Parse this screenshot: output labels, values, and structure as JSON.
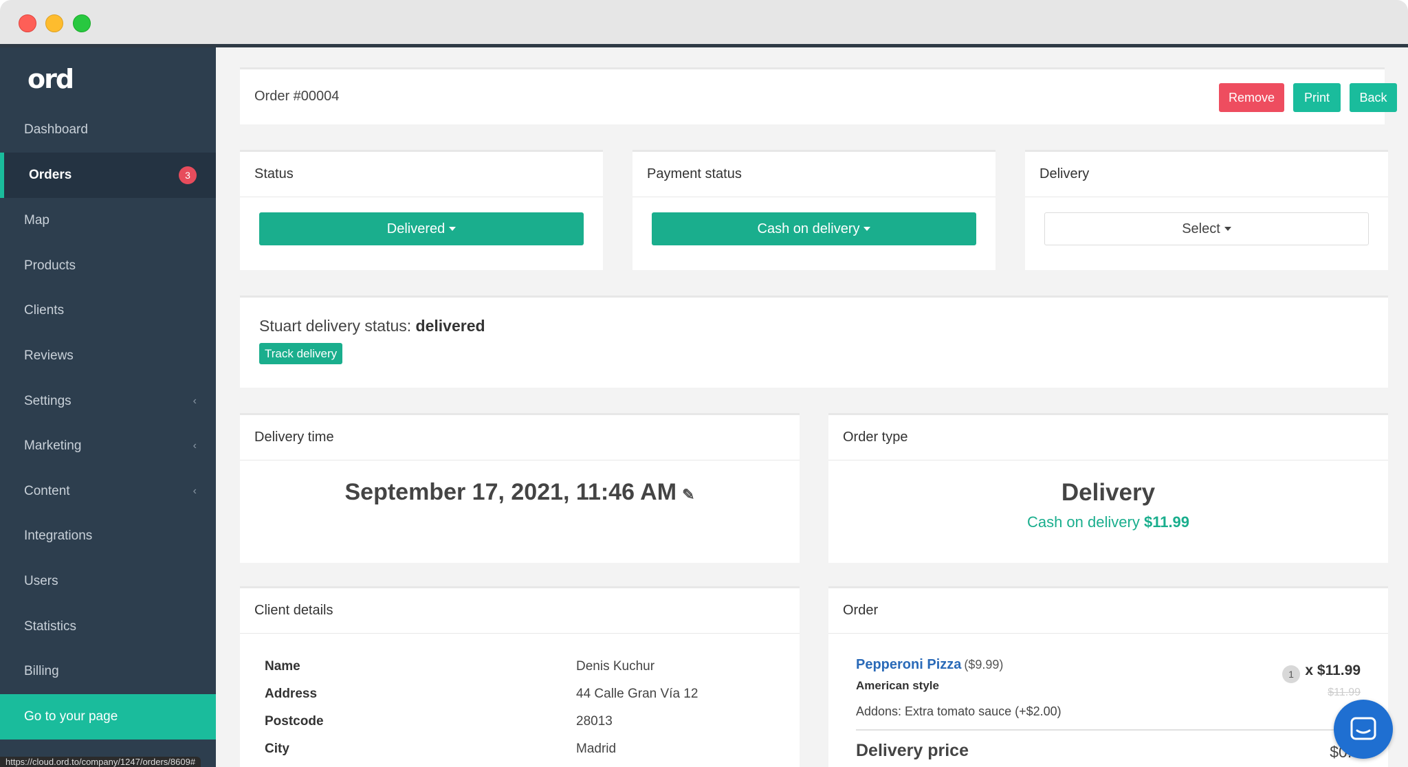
{
  "app": {
    "logo": "ord"
  },
  "sidebar": {
    "items": [
      {
        "label": "Dashboard"
      },
      {
        "label": "Orders",
        "badge": "3"
      },
      {
        "label": "Map"
      },
      {
        "label": "Products"
      },
      {
        "label": "Clients"
      },
      {
        "label": "Reviews"
      },
      {
        "label": "Settings"
      },
      {
        "label": "Marketing"
      },
      {
        "label": "Content"
      },
      {
        "label": "Integrations"
      },
      {
        "label": "Users"
      },
      {
        "label": "Statistics"
      },
      {
        "label": "Billing"
      }
    ],
    "go_page_label": "Go to your page"
  },
  "header": {
    "title": "Order #00004",
    "remove_label": "Remove",
    "print_label": "Print",
    "back_label": "Back"
  },
  "status_card": {
    "title": "Status",
    "value": "Delivered"
  },
  "payment_card": {
    "title": "Payment status",
    "value": "Cash on delivery"
  },
  "delivery_card": {
    "title": "Delivery",
    "value": "Select"
  },
  "stuart": {
    "label": "Stuart delivery status:",
    "status": "delivered",
    "track_label": "Track delivery"
  },
  "delivery_time": {
    "title": "Delivery time",
    "value": "September 17, 2021, 11:46 AM"
  },
  "order_type": {
    "title": "Order type",
    "value": "Delivery",
    "payment_label": "Cash on delivery",
    "payment_amount": "$11.99"
  },
  "client_details": {
    "title": "Client details",
    "rows": [
      {
        "key": "Name",
        "value": "Denis Kuchur"
      },
      {
        "key": "Address",
        "value": "44 Calle Gran Vía 12"
      },
      {
        "key": "Postcode",
        "value": "28013"
      },
      {
        "key": "City",
        "value": "Madrid"
      }
    ]
  },
  "order": {
    "title": "Order",
    "item_name": "Pepperoni Pizza",
    "item_unit_price": "($9.99)",
    "item_style": "American style",
    "item_addons": "Addons: Extra tomato sauce (+$2.00)",
    "quantity": "1",
    "line_total": "x $11.99",
    "line_total_old": "$11.99",
    "delivery_price_label": "Delivery price",
    "delivery_price_value": "$0.0"
  },
  "statusbar": {
    "url": "https://cloud.ord.to/company/1247/orders/8609#"
  },
  "colors": {
    "accent": "#1abc9c",
    "danger": "#ee4d5f",
    "sidebar_bg": "#2d3e4e",
    "link": "#2a6ab8"
  },
  "icons": {
    "pencil": "pencil-icon",
    "chat": "chat-icon",
    "chevron": "chevron-left-icon"
  }
}
